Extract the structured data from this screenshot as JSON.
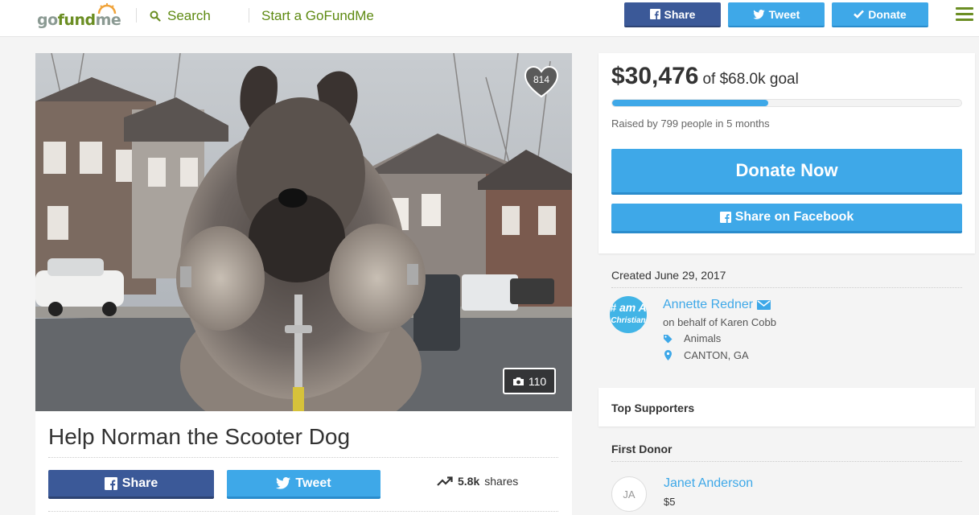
{
  "header": {
    "logo": {
      "go": "go",
      "fund": "fund",
      "me": "me"
    },
    "search_label": "Search",
    "start_label": "Start a GoFundMe",
    "share_label": "Share",
    "tweet_label": "Tweet",
    "donate_label": "Donate"
  },
  "campaign": {
    "title": "Help Norman the Scooter Dog",
    "hearts": "814",
    "photo_count": "110",
    "share_label": "Share",
    "tweet_label": "Tweet",
    "shares_count": "5.8k",
    "shares_label": "shares"
  },
  "donation": {
    "raised": "$30,476",
    "goal_text": "of $68.0k goal",
    "progress_fraction": 0.448,
    "raised_by": "Raised by 799 people in 5 months",
    "donate_now_label": "Donate Now",
    "share_fb_label": "Share on Facebook"
  },
  "details": {
    "created": "Created June 29, 2017",
    "avatar_text_line1": "# am A",
    "avatar_text_line2": "Christian",
    "organizer": "Annette Redner",
    "on_behalf": "on behalf of Karen Cobb",
    "category": "Animals",
    "location": "CANTON, GA"
  },
  "supporters": {
    "top_label": "Top Supporters",
    "first_donor_label": "First Donor",
    "donor_initials": "JA",
    "donor_name": "Janet Anderson",
    "donor_amount": "$5"
  },
  "colors": {
    "brand_green": "#6b8e23",
    "facebook": "#3b5998",
    "accent_blue": "#3ea8e8"
  }
}
